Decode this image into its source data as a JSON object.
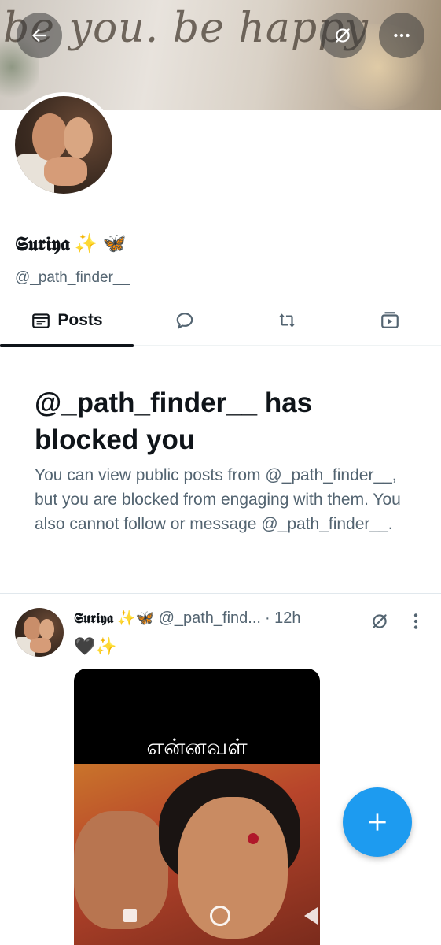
{
  "banner": {
    "text": "be you. be happy"
  },
  "header": {
    "back_icon": "arrow-left-icon",
    "grok_icon": "grok-slash-icon",
    "more_icon": "more-horizontal-icon"
  },
  "profile": {
    "display_name": "𝕾𝖚𝖗𝖎𝖞𝖆",
    "emojis": [
      "✨",
      "🦋"
    ],
    "handle": "@_path_finder__"
  },
  "tabs": [
    {
      "label": "Posts",
      "icon": "posts-icon",
      "selected": true
    },
    {
      "label": "",
      "icon": "reply-bubble-icon"
    },
    {
      "label": "",
      "icon": "repost-icon"
    },
    {
      "label": "",
      "icon": "media-play-icon"
    }
  ],
  "blocked": {
    "title": "@_path_finder__ has blocked you",
    "message": "You can view public posts from @_path_finder__, but you are blocked from engaging with them. You also cannot follow or message @_path_finder__."
  },
  "post": {
    "author_name": "𝕾𝖚𝖗𝖎𝖞𝖆",
    "author_emojis": "✨🦋",
    "handle": "@_path_find...",
    "time": "· 12h",
    "text_emojis": "🖤✨",
    "media_caption": "என்னவள்"
  },
  "fab": {
    "icon": "plus-icon"
  },
  "colors": {
    "accent": "#1d9bf0",
    "text": "#0f1419",
    "muted": "#536471"
  }
}
